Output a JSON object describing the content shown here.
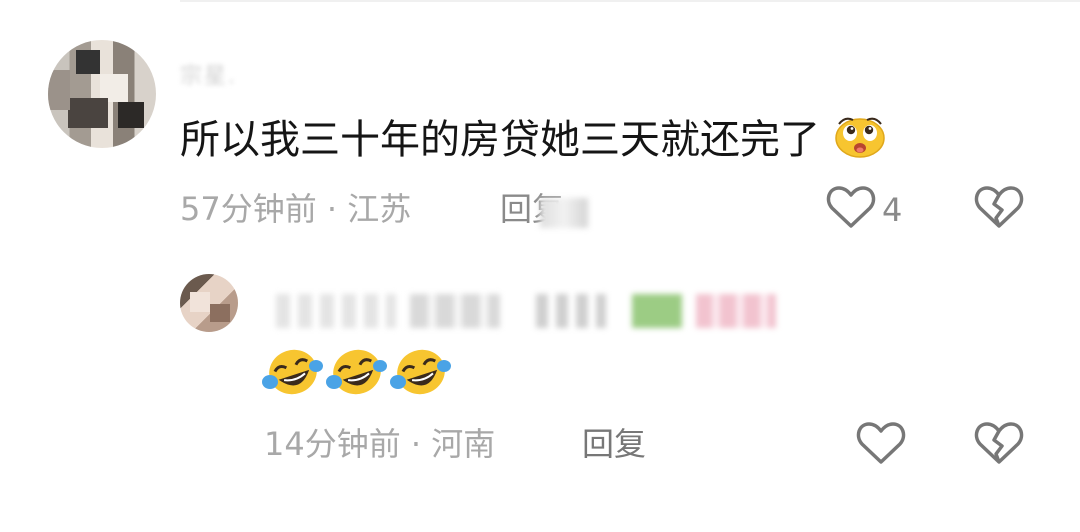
{
  "comments": [
    {
      "username": "宗星.",
      "text": "所以我三十年的房贷她三天就还完了",
      "time": "57分钟前",
      "separator": "·",
      "location": "江苏",
      "reply_label": "回复",
      "like_count": "4"
    },
    {
      "time": "14分钟前",
      "separator": "·",
      "location": "河南",
      "reply_label": "回复"
    }
  ],
  "icons": {
    "like": "heart-outline-icon",
    "dislike": "broken-heart-icon",
    "emoji_inline": "pleading-face-emoji",
    "emoji_reply": "laughing-tears-emoji"
  },
  "colors": {
    "text_primary": "#151515",
    "text_meta": "#a8a8a8",
    "icon_gray": "#777777",
    "emoji_yellow": "#f7c530",
    "emoji_blue": "#4aa3e6"
  }
}
